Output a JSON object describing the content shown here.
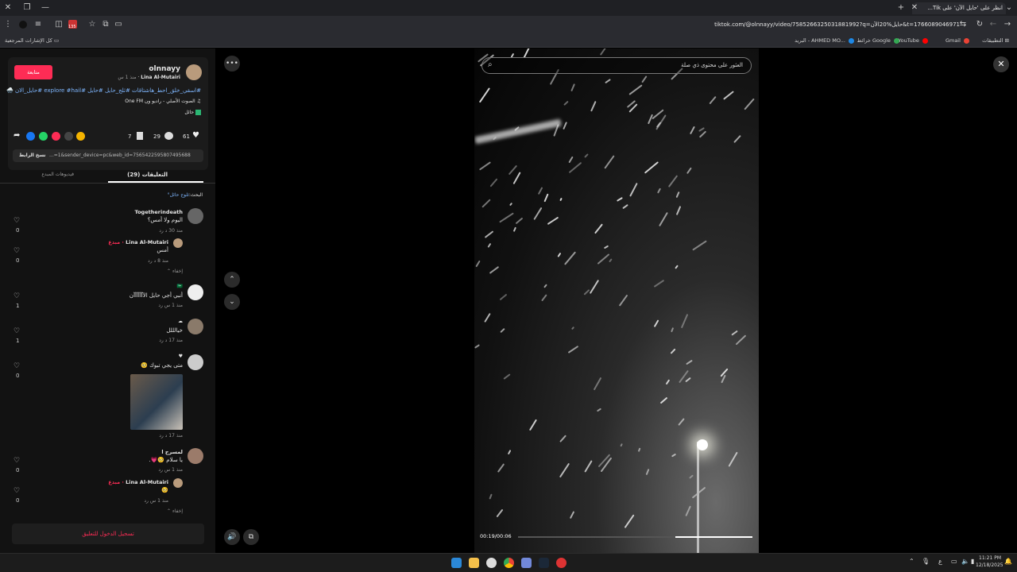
{
  "browser": {
    "tab_title": "انظر على 'حايل الآن' على Tik...",
    "url": "tiktok.com/@olnnayy/video/7585266325031881992?q=حايل%20الآن&t=1766089046971",
    "bookmarks": [
      "التطبيقات",
      "Gmail",
      "YouTube",
      "خرائط Google",
      "البريد - AHMED MO..."
    ],
    "all_bookmarks": "كل الإشارات المرجعية",
    "badge_count": "135"
  },
  "post": {
    "username": "olnnayy",
    "display_name": "Lina Al-Mutairi",
    "time_ago": "منذ 1 س",
    "follow_label": "متابعة",
    "caption": "#اسقي_خلق_احط_هاشتاقات #ثلج_حايل #حايل #explore #hail #حايل_الان 🌨️",
    "sound": "الصوت الأصلي - راديو ون One FM",
    "location": "حائل",
    "likes": "61",
    "comments": "29",
    "saves": "7",
    "link_text": "...=1&sender_device=pc&web_id=7565422595807495688",
    "copy_link": "نسخ الرابط"
  },
  "tabs": {
    "comments": "التعليقات (29)",
    "creator_videos": "فيديوهات المبدع"
  },
  "search_hint": {
    "label": "البحث:",
    "term": "ثلوج حائل"
  },
  "comments": [
    {
      "user": "Togetherindeath",
      "text": "اليوم ولا أمس؟",
      "meta": "منذ 30 د   رد",
      "likes": "0"
    },
    {
      "user": "Lina Al-Mutairi",
      "creator_tag": "· مبدع",
      "text": "أمس",
      "meta": "منذ 8 د   رد",
      "likes": "0",
      "hide": "إخفاء"
    },
    {
      "user": "",
      "text": "أنبي أجي حايل الآآآآآآآن",
      "meta": "منذ 1 س   رد",
      "likes": "1"
    },
    {
      "user": "",
      "text": "خيالللل",
      "meta": "منذ 17 د   رد",
      "likes": "1"
    },
    {
      "user": "",
      "text": "متى يجي تبوك 🥺",
      "meta": "منذ 17 د   رد",
      "likes": "0"
    },
    {
      "user": "لمسرح ا",
      "text": "يا سلام 🥺💗.",
      "meta": "منذ 1 س   رد",
      "likes": "0"
    },
    {
      "user": "Lina Al-Mutairi",
      "creator_tag": "· مبدع",
      "text": "🥺",
      "meta": "منذ 1 س   رد",
      "likes": "0",
      "hide": "إخفاء"
    }
  ],
  "login_prompt": "تسجيل الدخول للتعليق",
  "video": {
    "search_placeholder": "العثور على محتوى ذي صلة",
    "time": "00:19/00:06",
    "progress_percent": 33
  },
  "taskbar": {
    "time": "11:21 PM",
    "date": "12/18/2025",
    "lang": "ع"
  }
}
